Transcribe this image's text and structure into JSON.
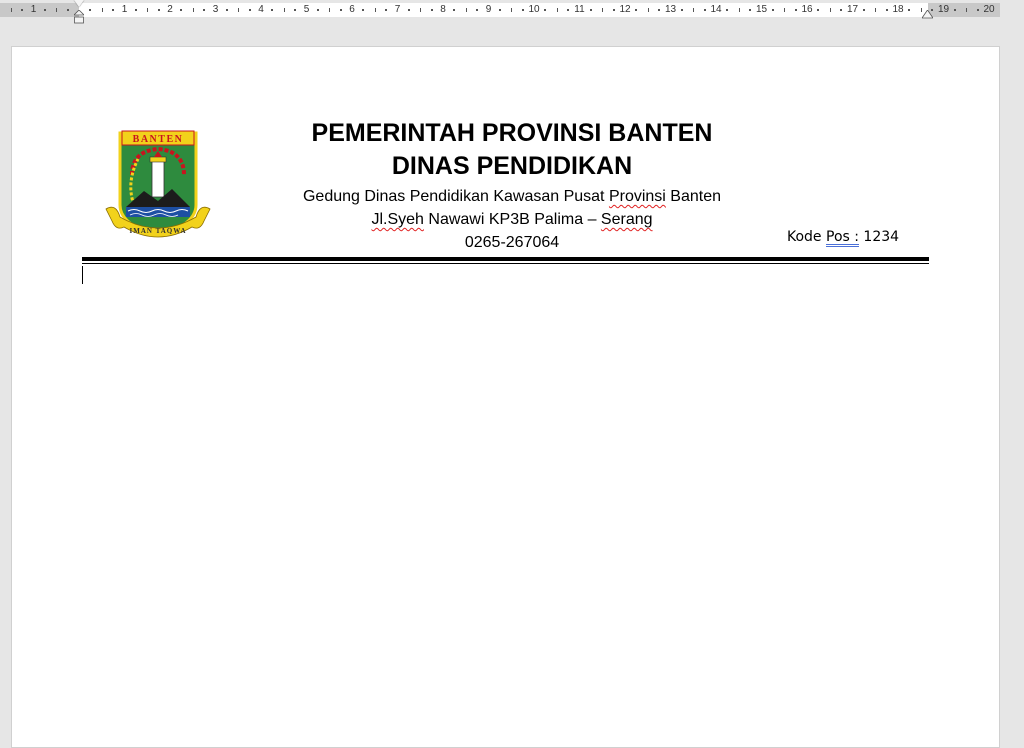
{
  "ruler": {
    "labels": [
      "1",
      "1",
      "2",
      "3",
      "4",
      "5",
      "6",
      "7",
      "8",
      "9",
      "10",
      "11",
      "12",
      "13",
      "14",
      "15",
      "16",
      "17",
      "18",
      "19",
      "20"
    ]
  },
  "letterhead": {
    "logo": {
      "banner_text": "BANTEN",
      "ribbon_text": "IMAN TAQWA",
      "colors": {
        "green": "#2e8b3e",
        "yellow": "#f2d21b",
        "red": "#c8141e",
        "blue": "#1d4fa3"
      }
    },
    "title_line1": "PEMERINTAH PROVINSI BANTEN",
    "title_line2": "DINAS PENDIDIKAN",
    "address_line1_pre": "Gedung Dinas Pendidikan Kawasan Pusat ",
    "address_line1_flag": "Provinsi",
    "address_line1_post": " Banten",
    "address_line2_flag1": "Jl.Syeh",
    "address_line2_mid": " Nawawi KP3B Palima – ",
    "address_line2_flag2": "Serang",
    "phone": "0265-267064",
    "kodepos_label": "Kode ",
    "kodepos_flag": "Pos :",
    "kodepos_value": " 1234"
  }
}
